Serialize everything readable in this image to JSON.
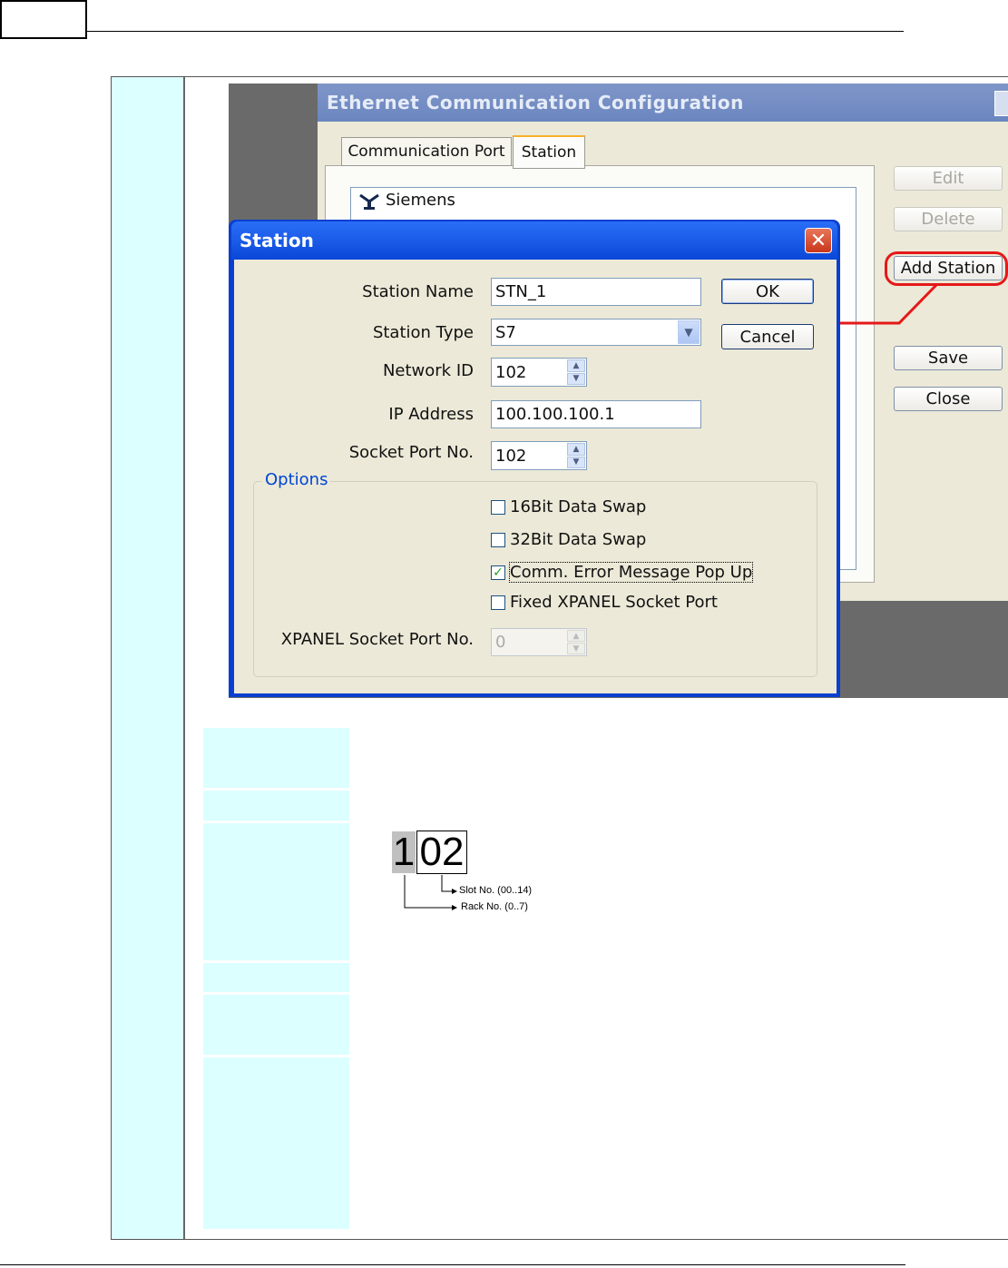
{
  "eth_window": {
    "title": "Ethernet Communication Configuration",
    "tabs": [
      {
        "label": "Communication Port"
      },
      {
        "label": "Station"
      }
    ],
    "tree_item": "Siemens",
    "buttons": {
      "edit": "Edit",
      "delete": "Delete",
      "add_station": "Add Station",
      "save": "Save",
      "close": "Close"
    }
  },
  "station_dialog": {
    "title": "Station",
    "close_glyph": "✕",
    "labels": {
      "station_name": "Station Name",
      "station_type": "Station Type",
      "network_id": "Network ID",
      "ip_address": "IP Address",
      "socket_port": "Socket Port No.",
      "xpanel_socket_port": "XPANEL Socket Port No."
    },
    "values": {
      "station_name": "STN_1",
      "station_type": "S7",
      "network_id": "102",
      "ip_address": "100.100.100.1",
      "socket_port": "102",
      "xpanel_socket_port": "0"
    },
    "buttons": {
      "ok": "OK",
      "cancel": "Cancel"
    },
    "options": {
      "group_label": "Options",
      "items": [
        {
          "label": "16Bit Data Swap",
          "checked": false
        },
        {
          "label": "32Bit Data Swap",
          "checked": false
        },
        {
          "label": "Comm. Error Message Pop Up",
          "checked": true
        },
        {
          "label": "Fixed XPANEL Socket Port",
          "checked": false
        }
      ]
    }
  },
  "diagram": {
    "first_digit": "1",
    "rest_digits": "02",
    "slot_label": "Slot No. (00..14)",
    "rack_label": "Rack No. (0..7)"
  },
  "colors": {
    "highlight_red": "#e41919",
    "cell_cyan": "#dcffff",
    "dialog_blue": "#0a48d8"
  }
}
